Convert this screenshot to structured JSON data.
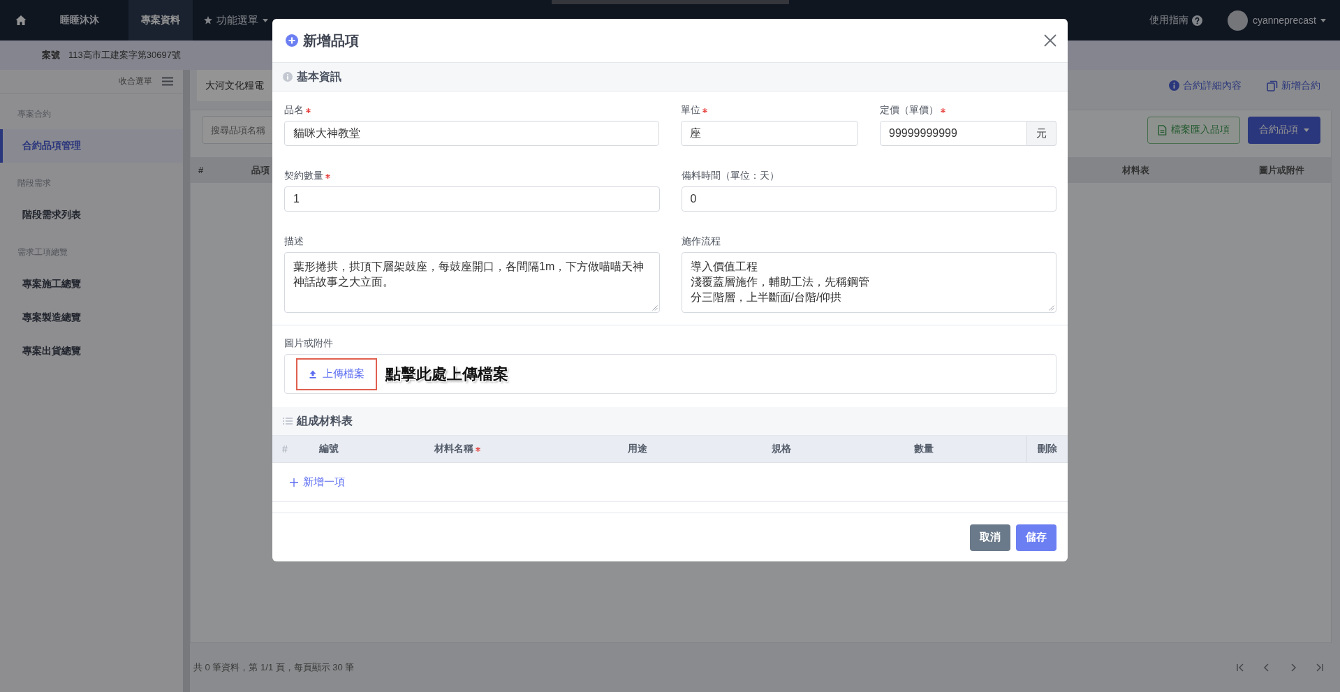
{
  "top_nav": {
    "project": "睡睡沐沐",
    "tabs": [
      {
        "label": "專案資料",
        "selected": true
      }
    ],
    "menu": "功能選單",
    "help": "使用指南",
    "user": "cyanneprecast"
  },
  "case_bar": {
    "label": "案號",
    "value": "113高市工建案字第30697號"
  },
  "sidebar": {
    "collapse": "收合選單",
    "sections": [
      {
        "title": "專案合約",
        "items": [
          {
            "label": "合約品項管理",
            "selected": true
          }
        ]
      },
      {
        "title": "階段需求",
        "items": [
          {
            "label": "階段需求列表",
            "selected": false
          }
        ]
      },
      {
        "title": "需求工項總覽",
        "items": [
          {
            "label": "專案施工總覽",
            "selected": false
          },
          {
            "label": "專案製造總覽",
            "selected": false
          },
          {
            "label": "專案出貨總覽",
            "selected": false
          }
        ]
      }
    ]
  },
  "content": {
    "tabs": [
      {
        "label": "大河文化糧電",
        "selected": true
      }
    ],
    "actions": [
      {
        "label": "合約詳細內容",
        "kind": "details"
      },
      {
        "label": "新增合約",
        "kind": "new"
      }
    ],
    "search": {
      "placeholder": "搜尋品項名稱"
    },
    "import_button": "檔案匯入品項",
    "menu_button": "合約品項",
    "columns": [
      "#",
      "品項",
      "材料表",
      "圖片或附件"
    ],
    "summary": "共 0 筆資料，第 1/1 頁，每頁顯示 30 筆"
  },
  "modal": {
    "title": "新增品項",
    "basic": {
      "title": "基本資訊",
      "rows": [
        [
          {
            "label": "品名",
            "required": true,
            "kind": "text",
            "value": "貓咪大神教堂"
          },
          {
            "label": "單位",
            "required": true,
            "kind": "text",
            "value": "座"
          },
          {
            "label": "定價（單價）",
            "required": true,
            "kind": "addon",
            "value": "99999999999",
            "suffix": "元"
          }
        ],
        [
          {
            "label": "契約數量",
            "required": true,
            "kind": "text",
            "value": "1"
          },
          {
            "label": "備料時間（單位：天）",
            "required": false,
            "kind": "text",
            "value": "0"
          }
        ],
        [
          {
            "label": "描述",
            "required": false,
            "kind": "textarea",
            "lines": [
              "葉形捲拱，拱頂下層架鼓座，每鼓座開口，各間隔1m，下方做喵喵天神神話故事之大立面。"
            ]
          },
          {
            "label": "施作流程",
            "required": false,
            "kind": "textarea",
            "lines": [
              "導入價值工程",
              "淺覆蓋層施作，輔助工法，先稱鋼管",
              "分三階層，上半斷面/台階/仰拱"
            ]
          }
        ]
      ]
    },
    "attachments": {
      "label": "圖片或附件",
      "upload_button": "上傳檔案",
      "highlighted": true,
      "annotation": "點擊此處上傳檔案"
    },
    "materials": {
      "title": "組成材料表",
      "columns": [
        {
          "label": "#",
          "required": false
        },
        {
          "label": "編號",
          "required": false
        },
        {
          "label": "材料名稱",
          "required": true
        },
        {
          "label": "用途",
          "required": false
        },
        {
          "label": "規格",
          "required": false
        },
        {
          "label": "數量",
          "required": false
        },
        {
          "label": "刪除",
          "required": false
        }
      ],
      "add_link": "新增一項"
    },
    "buttons": [
      {
        "label": "取消",
        "kind": "secondary"
      },
      {
        "label": "儲存",
        "kind": "primary"
      }
    ]
  }
}
